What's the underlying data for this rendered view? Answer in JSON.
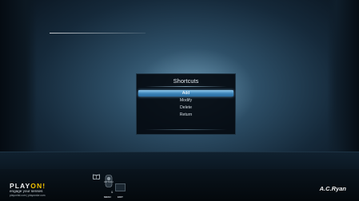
{
  "dialog": {
    "title": "Shortcuts",
    "items": [
      {
        "label": "Add",
        "selected": true
      },
      {
        "label": "Modify",
        "selected": false
      },
      {
        "label": "Delete",
        "selected": false
      },
      {
        "label": "Return",
        "selected": false
      }
    ]
  },
  "footer": {
    "logo_main": "PLAY",
    "logo_accent": "ON!",
    "tagline": "engage your senses",
    "urls": "playonhd.com | playondvr.com",
    "keys": {
      "top_label": "OPTION",
      "amp": "&",
      "menu_label": "MENU",
      "edit_label": "EDIT"
    },
    "brand": "A.C.Ryan"
  },
  "colors": {
    "selection": "#3b83b8",
    "logo_accent": "#f4c400"
  }
}
